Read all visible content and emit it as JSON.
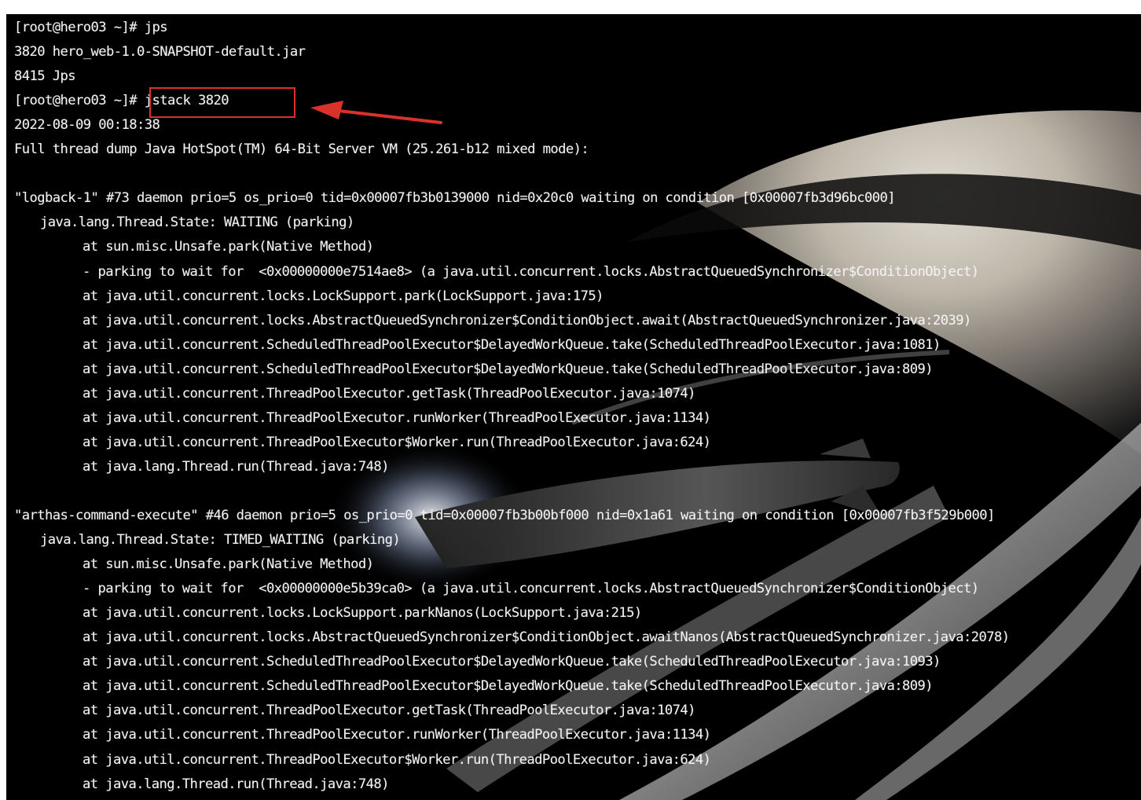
{
  "terminal": {
    "lines": [
      "[root@hero03 ~]# jps",
      "3820 hero_web-1.0-SNAPSHOT-default.jar",
      "8415 Jps",
      "[root@hero03 ~]# jstack 3820",
      "2022-08-09 00:18:38",
      "Full thread dump Java HotSpot(TM) 64-Bit Server VM (25.261-b12 mixed mode):",
      "",
      "\"logback-1\" #73 daemon prio=5 os_prio=0 tid=0x00007fb3b0139000 nid=0x20c0 waiting on condition [0x00007fb3d96bc000]",
      "java.lang.Thread.State: WAITING (parking)",
      "at sun.misc.Unsafe.park(Native Method)",
      "- parking to wait for  <0x00000000e7514ae8> (a java.util.concurrent.locks.AbstractQueuedSynchronizer$ConditionObject)",
      "at java.util.concurrent.locks.LockSupport.park(LockSupport.java:175)",
      "at java.util.concurrent.locks.AbstractQueuedSynchronizer$ConditionObject.await(AbstractQueuedSynchronizer.java:2039)",
      "at java.util.concurrent.ScheduledThreadPoolExecutor$DelayedWorkQueue.take(ScheduledThreadPoolExecutor.java:1081)",
      "at java.util.concurrent.ScheduledThreadPoolExecutor$DelayedWorkQueue.take(ScheduledThreadPoolExecutor.java:809)",
      "at java.util.concurrent.ThreadPoolExecutor.getTask(ThreadPoolExecutor.java:1074)",
      "at java.util.concurrent.ThreadPoolExecutor.runWorker(ThreadPoolExecutor.java:1134)",
      "at java.util.concurrent.ThreadPoolExecutor$Worker.run(ThreadPoolExecutor.java:624)",
      "at java.lang.Thread.run(Thread.java:748)",
      "",
      "\"arthas-command-execute\" #46 daemon prio=5 os_prio=0 tid=0x00007fb3b00bf000 nid=0x1a61 waiting on condition [0x00007fb3f529b000]",
      "java.lang.Thread.State: TIMED_WAITING (parking)",
      "at sun.misc.Unsafe.park(Native Method)",
      "- parking to wait for  <0x00000000e5b39ca0> (a java.util.concurrent.locks.AbstractQueuedSynchronizer$ConditionObject)",
      "at java.util.concurrent.locks.LockSupport.parkNanos(LockSupport.java:215)",
      "at java.util.concurrent.locks.AbstractQueuedSynchronizer$ConditionObject.awaitNanos(AbstractQueuedSynchronizer.java:2078)",
      "at java.util.concurrent.ScheduledThreadPoolExecutor$DelayedWorkQueue.take(ScheduledThreadPoolExecutor.java:1093)",
      "at java.util.concurrent.ScheduledThreadPoolExecutor$DelayedWorkQueue.take(ScheduledThreadPoolExecutor.java:809)",
      "at java.util.concurrent.ThreadPoolExecutor.getTask(ThreadPoolExecutor.java:1074)",
      "at java.util.concurrent.ThreadPoolExecutor.runWorker(ThreadPoolExecutor.java:1134)",
      "at java.util.concurrent.ThreadPoolExecutor$Worker.run(ThreadPoolExecutor.java:624)",
      "at java.lang.Thread.run(Thread.java:748)"
    ]
  },
  "annotation": {
    "color": "#d9322a",
    "highlight": "jstack 3820",
    "arrow_icon": "arrow-left-icon"
  },
  "theme": {
    "background": "#000000",
    "text": "#f2f2f2"
  }
}
